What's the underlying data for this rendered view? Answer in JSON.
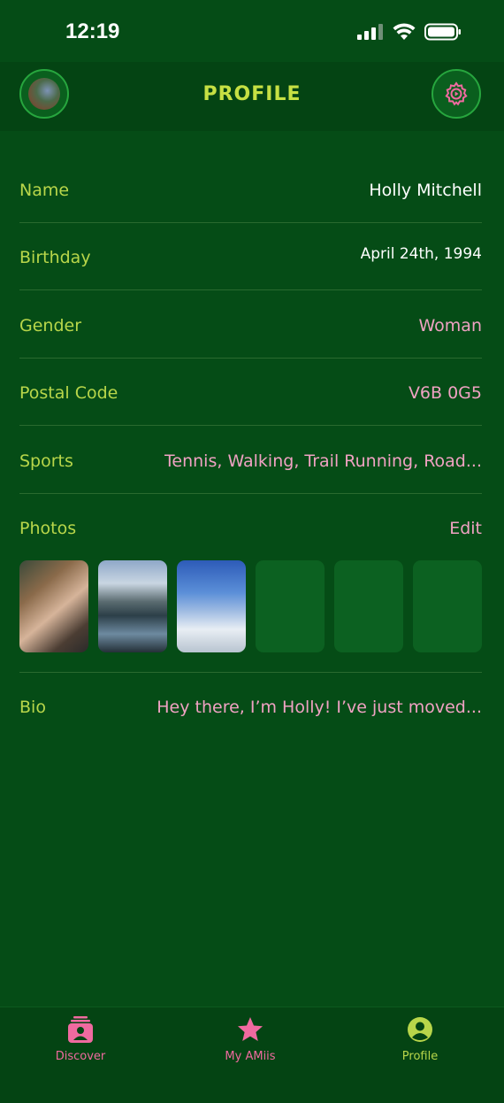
{
  "status": {
    "time": "12:19"
  },
  "header": {
    "title": "PROFILE"
  },
  "rows": [
    {
      "label": "Name",
      "value": "Holly Mitchell"
    },
    {
      "label": "Birthday",
      "value": "April 24th, 1994"
    },
    {
      "label": "Gender",
      "value": "Woman"
    },
    {
      "label": "Postal Code",
      "value": "V6B 0G5"
    },
    {
      "label": "Sports",
      "value": "Tennis, Walking, Trail Running, Road..."
    }
  ],
  "photos": {
    "label": "Photos",
    "edit": "Edit"
  },
  "bio": {
    "label": "Bio",
    "value": "Hey there, I’m Holly! I’ve just moved..."
  },
  "tabs": [
    {
      "label": "Discover",
      "icon": "person-card-icon"
    },
    {
      "label": "My AMiis",
      "icon": "star-icon"
    },
    {
      "label": "Profile",
      "icon": "profile-icon"
    }
  ],
  "colors": {
    "background": "#054c16",
    "accent_lime": "#c6e043",
    "accent_pink": "#f0a2c3",
    "tab_pink": "#f06aa0"
  }
}
